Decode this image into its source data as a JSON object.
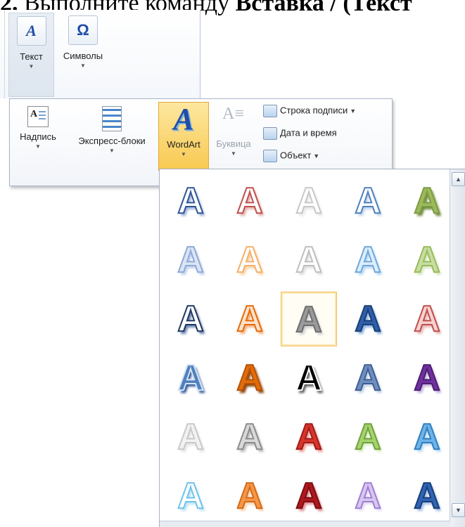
{
  "doc": {
    "prefix": "2.",
    "text": " Выполните команду ",
    "bold": "Вставка / (Текст"
  },
  "ribbon_top": {
    "text_button": {
      "label": "Текст",
      "icon": "text-a-icon"
    },
    "symbols_button": {
      "label": "Символы",
      "icon": "omega-icon",
      "glyph": "Ω"
    }
  },
  "ribbon_panel": {
    "textbox_button": {
      "label": "Надпись",
      "icon": "textbox-icon"
    },
    "quickparts_button": {
      "label": "Экспресс-блоки",
      "icon": "quick-parts-icon"
    },
    "wordart_button": {
      "label": "WordArt",
      "icon": "wordart-icon",
      "glyph": "A"
    },
    "dropcap_button": {
      "label": "Буквица",
      "icon": "drop-cap-icon",
      "glyph": "A≡"
    },
    "signature_line": {
      "label": "Строка подписи",
      "icon": "signature-line-icon"
    },
    "datetime": {
      "label": "Дата и время",
      "icon": "date-time-icon"
    },
    "object": {
      "label": "Объект",
      "icon": "object-icon"
    }
  },
  "gallery": {
    "glyph": "A",
    "rows": [
      [
        {
          "fill": "#ffffff",
          "stroke": "#2f5597",
          "shadow": "#9fb5d6"
        },
        {
          "fill": "#ffffff",
          "stroke": "#c0504d",
          "shadow": "#e4b3b1"
        },
        {
          "fill": "#ffffff",
          "stroke": "#c8c8c8",
          "shadow": "#e8e8e8"
        },
        {
          "fill": "#ffffff",
          "stroke": "#4f81bd",
          "shadow": "#c6d7ee"
        },
        {
          "fill": "#9bbb59",
          "stroke": "#7f9a48",
          "shadow": "#6e8a3b"
        }
      ],
      [
        {
          "fill": "#dbe5f1",
          "stroke": "#8eaadb",
          "shadow": "#c5d3ea"
        },
        {
          "fill": "#ffffff",
          "stroke": "#f5b06a",
          "shadow": "#fad3aa"
        },
        {
          "fill": "#ffffff",
          "stroke": "#bfbfbf",
          "shadow": "#e0e0e0"
        },
        {
          "fill": "#ddeefb",
          "stroke": "#6fa8dc",
          "shadow": "#bcd8f0"
        },
        {
          "fill": "#c6dea4",
          "stroke": "#9bbb59",
          "shadow": "#d7e8c0"
        }
      ],
      [
        {
          "fill": "#ffffff",
          "stroke": "#1f3864",
          "shadow": "#6d86b0"
        },
        {
          "fill": "#fde2cc",
          "stroke": "#e36c09",
          "shadow": "#f4b183"
        },
        {
          "fill": "#9a9a9a",
          "stroke": "#6e6e6e",
          "shadow": "#d0d0d0",
          "selected": true
        },
        {
          "fill": "#2e5fa7",
          "stroke": "#1a3f78",
          "shadow": "#8fb2e0"
        },
        {
          "fill": "#f6d2d1",
          "stroke": "#c0504d",
          "shadow": "#e8b7b6"
        }
      ],
      [
        {
          "fill": "#4f81bd",
          "stroke": "#d6e4f5",
          "shadow": "#2f5597"
        },
        {
          "fill": "#e36c09",
          "stroke": "#b45309",
          "shadow": "#8a4206"
        },
        {
          "fill": "#000000",
          "stroke": "#ffffff",
          "shadow": "#5a5a5a"
        },
        {
          "fill": "#6f8fc0",
          "stroke": "#3f5f90",
          "shadow": "#c2d3ea"
        },
        {
          "fill": "#7030a0",
          "stroke": "#4b1f6e",
          "shadow": "#c7b0dc"
        }
      ],
      [
        {
          "fill": "#f2f2f2",
          "stroke": "#c9c9c9",
          "shadow": "#e5e5e5"
        },
        {
          "fill": "#d9d9d9",
          "stroke": "#8c8c8c",
          "shadow": "#bfbfbf"
        },
        {
          "fill": "#d9332b",
          "stroke": "#9c1f1a",
          "shadow": "#f19e9a"
        },
        {
          "fill": "#a5d36f",
          "stroke": "#70a13b",
          "shadow": "#dcefc6"
        },
        {
          "fill": "#6fb3e8",
          "stroke": "#2f7fc2",
          "shadow": "#bcdcf5"
        }
      ],
      [
        {
          "fill": "#ffffff",
          "stroke": "#6fc3ea",
          "shadow": "#bfe5f6"
        },
        {
          "fill": "#f79646",
          "stroke": "#d06c1a",
          "shadow": "#fbd1ad"
        },
        {
          "fill": "#b0171d",
          "stroke": "#7a0f13",
          "shadow": "#e08b8e"
        },
        {
          "fill": "#d8c6f0",
          "stroke": "#9e7fd0",
          "shadow": "#e9def7"
        },
        {
          "fill": "#2f64b5",
          "stroke": "#1a3f78",
          "shadow": "#a3bfe6"
        }
      ]
    ]
  }
}
